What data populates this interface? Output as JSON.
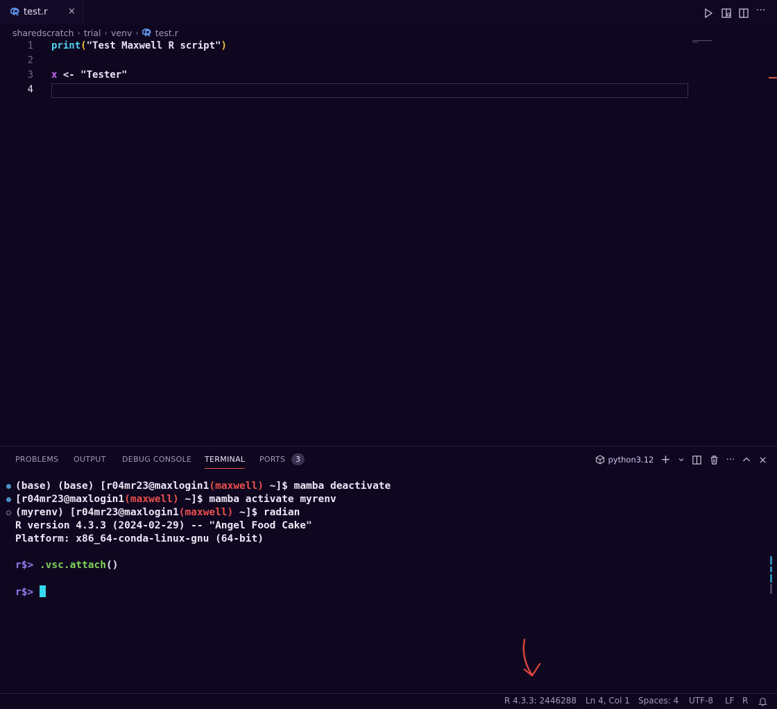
{
  "tab": {
    "title": "test.r",
    "close": "×"
  },
  "breadcrumb": [
    "sharedscratch",
    "trial",
    "venv",
    "test.r"
  ],
  "editor": {
    "lines": [
      {
        "number": "1",
        "tokens": [
          {
            "t": "print",
            "c": "fn"
          },
          {
            "t": "(",
            "c": "paren"
          },
          {
            "t": "\"Test Maxwell R script\"",
            "c": "str"
          },
          {
            "t": ")",
            "c": "paren"
          }
        ]
      },
      {
        "number": "2",
        "tokens": []
      },
      {
        "number": "3",
        "tokens": [
          {
            "t": "x",
            "c": "var"
          },
          {
            "t": " <- ",
            "c": "op"
          },
          {
            "t": "\"Tester\"",
            "c": "str"
          }
        ]
      },
      {
        "number": "4",
        "tokens": [],
        "active": true
      }
    ]
  },
  "panel": {
    "tabs": [
      "PROBLEMS",
      "OUTPUT",
      "DEBUG CONSOLE",
      "TERMINAL",
      "PORTS"
    ],
    "active_tab": "TERMINAL",
    "ports_count": "3",
    "shell": "python3.12",
    "add": "+",
    "more": "···"
  },
  "terminal": {
    "line1": {
      "a": "(base) (base) [r04mr23@maxlogin1",
      "host": "(maxwell)",
      "b": " ~]$ mamba deactivate"
    },
    "line2": {
      "a": "[r04mr23@maxlogin1",
      "host": "(maxwell)",
      "b": " ~]$ mamba activate myrenv"
    },
    "line3": {
      "a": "(myrenv) [r04mr23@maxlogin1",
      "host": "(maxwell)",
      "b": " ~]$ radian"
    },
    "line4": "R version 4.3.3 (2024-02-29) -- \"Angel Food Cake\"",
    "line5": "Platform: x86_64-conda-linux-gnu (64-bit)",
    "prompt": "r$>",
    "command": ".vsc.attach",
    "command_parens": "()"
  },
  "statusbar": {
    "r_session": "R 4.3.3: 2446288",
    "position": "Ln 4, Col 1",
    "spaces": "Spaces: 4",
    "encoding": "UTF-8",
    "eol": "LF",
    "language": "R"
  },
  "colors": {
    "accent": "#e05a4a",
    "background": "#0f0720",
    "cursor": "#37d9f0"
  }
}
